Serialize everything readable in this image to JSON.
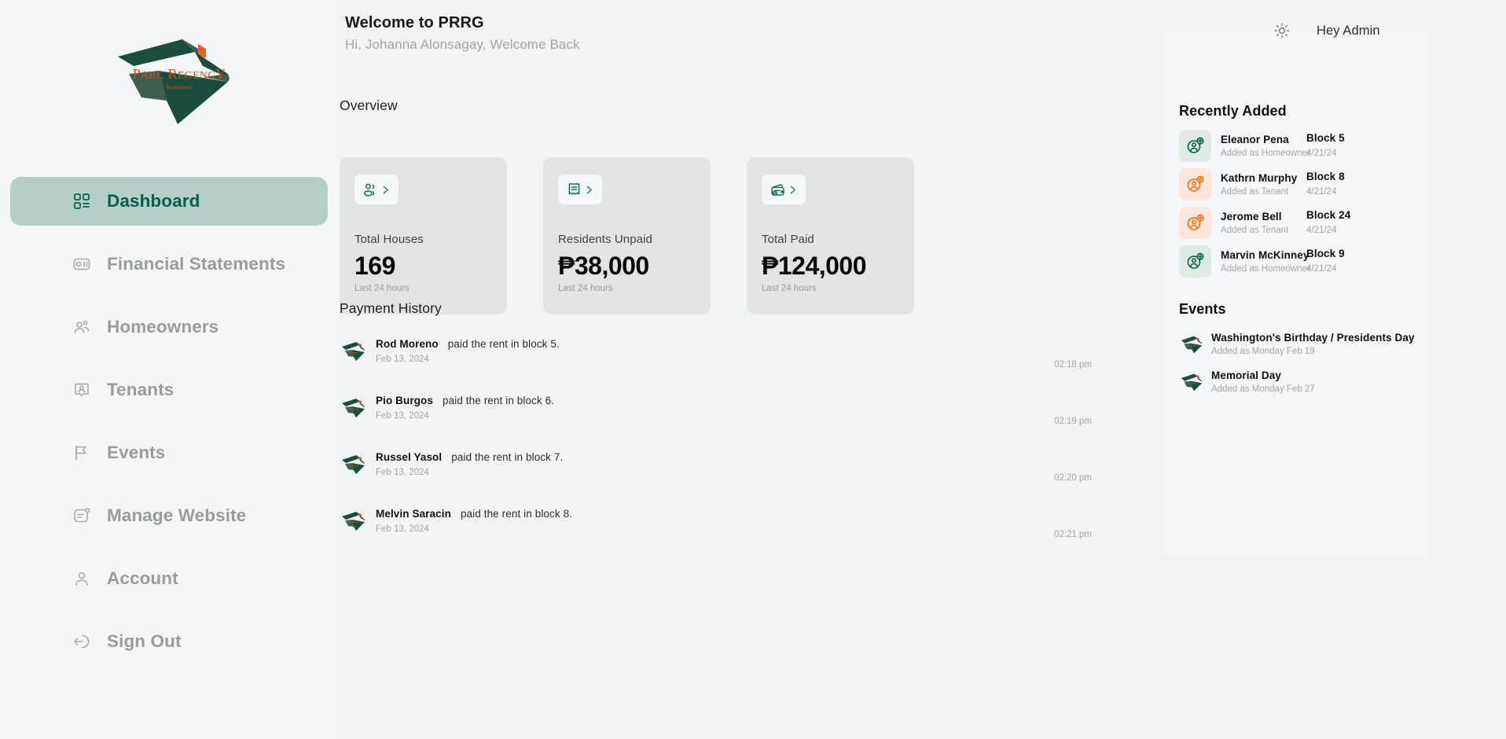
{
  "brand": {
    "logo_primary_text": "PARC REGENCY",
    "logo_secondary_text": "Residences",
    "logo_green": "#1b4d3e",
    "logo_orange": "#e8601c"
  },
  "sidebar": {
    "items": [
      {
        "label": "Dashboard",
        "icon": "grid-dashboard-icon",
        "active": true
      },
      {
        "label": "Financial Statements",
        "icon": "receipt-money-icon",
        "active": false
      },
      {
        "label": "Homeowners",
        "icon": "people-group-icon",
        "active": false
      },
      {
        "label": "Tenants",
        "icon": "user-badge-icon",
        "active": false
      },
      {
        "label": "Events",
        "icon": "flag-icon",
        "active": false
      },
      {
        "label": "Manage Website",
        "icon": "browser-note-icon",
        "active": false
      },
      {
        "label": "Account",
        "icon": "person-icon",
        "active": false
      },
      {
        "label": "Sign Out",
        "icon": "logout-arrow-icon",
        "active": false
      }
    ],
    "active_bg": "#b2cfc8",
    "active_text": "#0a5c4c"
  },
  "header": {
    "title": "Welcome to PRRG",
    "subtitle": "Hi, Johanna Alonsagay, Welcome Back",
    "theme_toggle_icon": "sun-icon",
    "admin_greeting": "Hey Admin"
  },
  "overview": {
    "title": "Overview",
    "cards": [
      {
        "icon": "people-group-icon",
        "label": "Total Houses",
        "value": "169",
        "footnote": "Last 24 hours"
      },
      {
        "icon": "invoice-icon",
        "label": "Residents Unpaid",
        "value": "₱38,000",
        "footnote": "Last 24 hours"
      },
      {
        "icon": "wallet-check-icon",
        "label": "Total Paid",
        "value": "₱124,000",
        "footnote": "Last 24 hours"
      }
    ]
  },
  "payment_history": {
    "title": "Payment History",
    "rows": [
      {
        "name": "Rod Moreno",
        "action": "paid the rent in block 5.",
        "date": "Feb 13, 2024",
        "time": "02:18 pm"
      },
      {
        "name": "Pio Burgos",
        "action": "paid the rent in block 6.",
        "date": "Feb 13, 2024",
        "time": "02:19 pm"
      },
      {
        "name": "Russel Yasol",
        "action": "paid the rent in block 7.",
        "date": "Feb 13, 2024",
        "time": "02:20 pm"
      },
      {
        "name": "Melvin Saracin",
        "action": "paid the rent in block 8.",
        "date": "Feb 13, 2024",
        "time": "02:21 pm"
      }
    ]
  },
  "recently_added": {
    "title": "Recently Added",
    "rows": [
      {
        "name": "Eleanor Pena",
        "role": "Added as Homeowner",
        "block": "Block 5",
        "date": "4/21/24",
        "tone": "green"
      },
      {
        "name": "Kathrn Murphy",
        "role": "Added as Tenant",
        "block": "Block 8",
        "date": "4/21/24",
        "tone": "orange"
      },
      {
        "name": "Jerome Bell",
        "role": "Added as Tenant",
        "block": "Block 24",
        "date": "4/21/24",
        "tone": "orange"
      },
      {
        "name": "Marvin McKinney",
        "role": "Added as Homeowner",
        "block": "Block 9",
        "date": "4/21/24",
        "tone": "green"
      }
    ]
  },
  "events": {
    "title": "Events",
    "rows": [
      {
        "name": "Washington's Birthday / Presidents Day",
        "sub": "Added as Monday Feb 19"
      },
      {
        "name": "Memorial Day",
        "sub": "Added as Monday Feb 27"
      }
    ]
  }
}
